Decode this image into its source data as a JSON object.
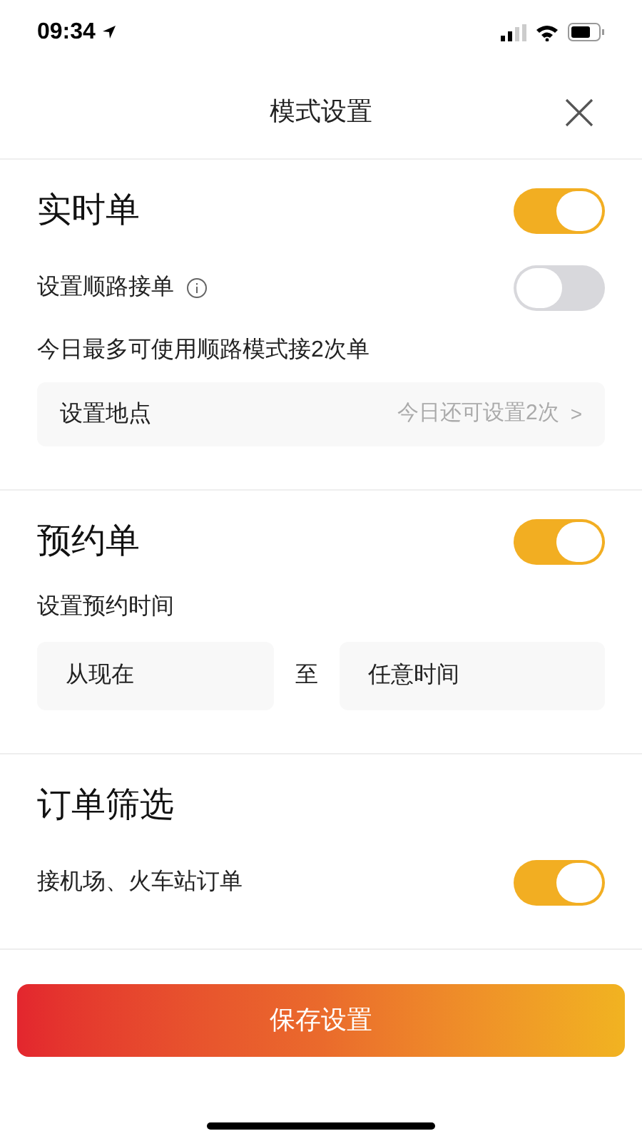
{
  "status_bar": {
    "time": "09:34"
  },
  "header": {
    "title": "模式设置"
  },
  "sections": [
    {
      "title": "实时单",
      "on": true,
      "rows": [
        {
          "kind": "toggle",
          "label": "设置顺路接单",
          "info": true,
          "on": false
        },
        {
          "kind": "note",
          "text": "今日最多可使用顺路模式接2次单"
        },
        {
          "kind": "link",
          "label": "设置地点",
          "value": "今日还可设置2次",
          "chevron": ">"
        }
      ]
    },
    {
      "title": "预约单",
      "on": true,
      "rows": [
        {
          "kind": "note",
          "text": "设置预约时间"
        },
        {
          "kind": "range",
          "from": "从现在",
          "separator": "至",
          "to": "任意时间"
        }
      ]
    },
    {
      "title": "订单筛选",
      "rows": [
        {
          "kind": "toggle",
          "label": "接机场、火车站订单",
          "info": false,
          "on": true
        }
      ]
    }
  ],
  "save_button": {
    "label": "保存设置"
  }
}
